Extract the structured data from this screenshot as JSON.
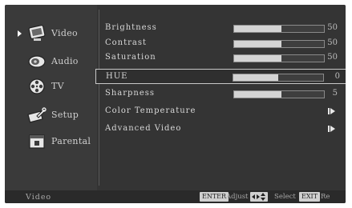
{
  "sidebar": {
    "items": [
      {
        "label": "Video",
        "icon": "monitor-icon",
        "active": true
      },
      {
        "label": "Audio",
        "icon": "speaker-icon",
        "active": false
      },
      {
        "label": "TV",
        "icon": "film-reel-icon",
        "active": false
      },
      {
        "label": "Setup",
        "icon": "wrench-icon",
        "active": false
      },
      {
        "label": "Parental",
        "icon": "lock-icon",
        "active": false
      }
    ]
  },
  "settings": [
    {
      "label": "Brightness",
      "value": "50",
      "level": 0.53
    },
    {
      "label": "Contrast",
      "value": "50",
      "level": 0.53
    },
    {
      "label": "Saturation",
      "value": "50",
      "level": 0.53
    },
    {
      "label": "HUE",
      "value": "0",
      "level": 0.5,
      "selected": true
    },
    {
      "label": "Sharpness",
      "value": "5",
      "level": 0.53
    },
    {
      "label": "Color Temperature",
      "has_submenu": true
    },
    {
      "label": "Advanced Video",
      "has_submenu": true
    }
  ],
  "status_bar": {
    "title": "Video",
    "enter_key": "ENTER",
    "adjust_label": "Adjust",
    "select_label": "Select",
    "exit_key": "EXIT",
    "exit_label": "Re"
  },
  "colors": {
    "background": "#343434",
    "text": "#d8d8d8",
    "bar_fill": "#d4d4d4",
    "selection_border": "#c8c8c8"
  }
}
